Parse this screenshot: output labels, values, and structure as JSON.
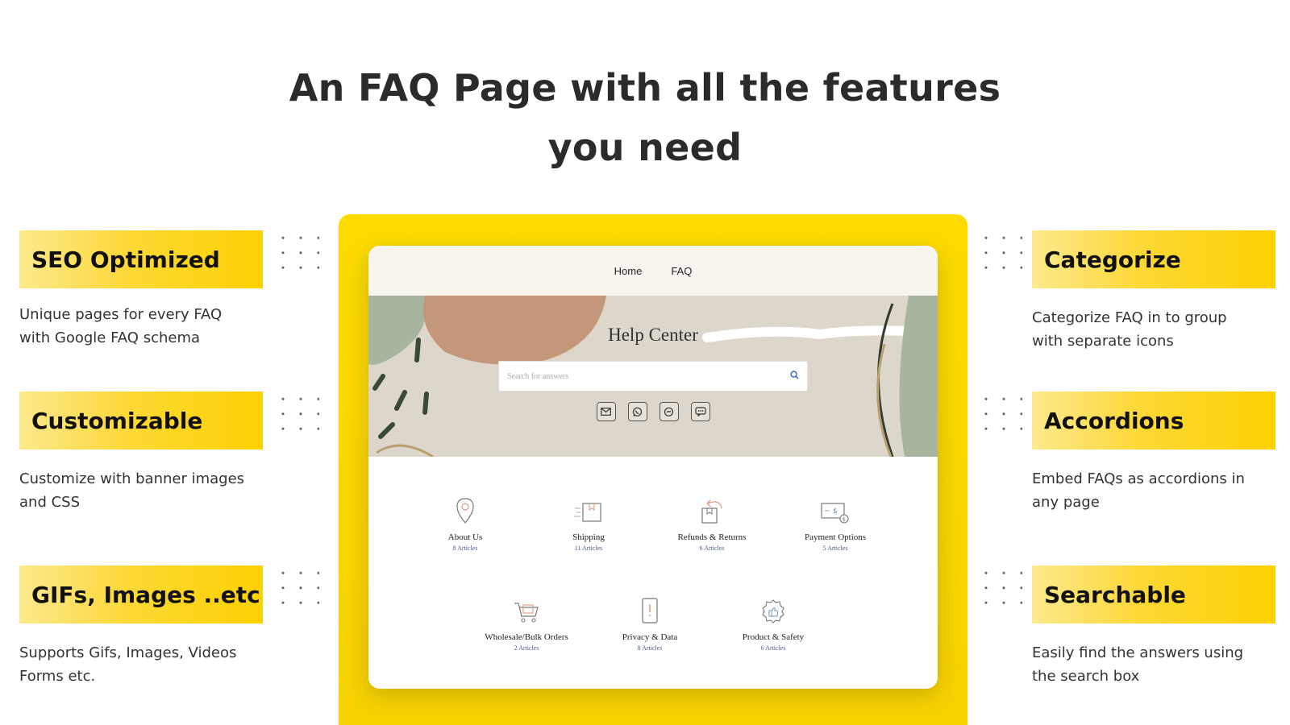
{
  "headline": {
    "line1": "An FAQ Page with all the features",
    "line2": "you need"
  },
  "features_left": [
    {
      "title": "SEO Optimized",
      "desc_line1": "Unique pages for every FAQ",
      "desc_line2": "with Google FAQ schema"
    },
    {
      "title": "Customizable",
      "desc_line1": "Customize with banner images",
      "desc_line2": "and CSS"
    },
    {
      "title": "GIFs, Images ..etc",
      "desc_line1": "Supports Gifs, Images, Videos",
      "desc_line2": "Forms etc."
    }
  ],
  "features_right": [
    {
      "title": "Categorize",
      "desc_line1": "Categorize FAQ in to group",
      "desc_line2": "with separate icons"
    },
    {
      "title": "Accordions",
      "desc_line1": "Embed FAQs as accordions in",
      "desc_line2": "any page"
    },
    {
      "title": "Searchable",
      "desc_line1": "Easily find the answers using",
      "desc_line2": "the search box"
    }
  ],
  "site": {
    "nav": {
      "home": "Home",
      "faq": "FAQ"
    },
    "banner": {
      "title": "Help Center",
      "search_placeholder": "Search for answers"
    },
    "contact_icons": [
      "email-icon",
      "whatsapp-icon",
      "messenger-icon",
      "chat-icon"
    ],
    "categories": [
      {
        "name": "About Us",
        "count": "8 Articles",
        "icon": "location-pin-icon"
      },
      {
        "name": "Shipping",
        "count": "11 Articles",
        "icon": "shipping-box-icon"
      },
      {
        "name": "Refunds & Returns",
        "count": "6 Articles",
        "icon": "return-box-icon"
      },
      {
        "name": "Payment Options",
        "count": "5 Articles",
        "icon": "payment-card-icon"
      },
      {
        "name": "Wholesale/Bulk Orders",
        "count": "2 Articles",
        "icon": "cart-icon"
      },
      {
        "name": "Privacy & Data",
        "count": "8 Articles",
        "icon": "privacy-phone-icon"
      },
      {
        "name": "Product & Safety",
        "count": "6 Articles",
        "icon": "safety-badge-icon"
      }
    ]
  },
  "colors": {
    "accent_yellow": "#fdd100",
    "banner_bg": "#ddd6cb",
    "count_blue": "#4a5a8c"
  }
}
